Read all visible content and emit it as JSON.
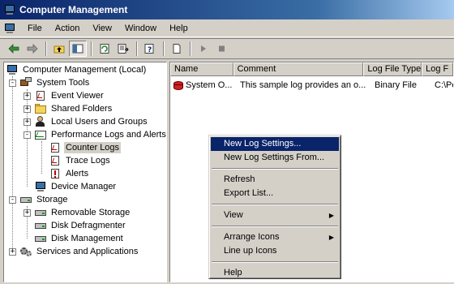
{
  "window": {
    "title": "Computer Management"
  },
  "menubar": {
    "items": [
      "File",
      "Action",
      "View",
      "Window",
      "Help"
    ]
  },
  "toolbar": {
    "buttons": [
      "back-arrow-icon",
      "forward-arrow-icon",
      "up-folder-icon",
      "show-hide-tree-icon",
      "refresh-icon",
      "export-list-icon",
      "help-icon",
      "new-log-icon",
      "start-icon",
      "stop-icon"
    ]
  },
  "tree": {
    "root": "Computer Management (Local)",
    "system_tools": "System Tools",
    "event_viewer": "Event Viewer",
    "shared_folders": "Shared Folders",
    "local_users": "Local Users and Groups",
    "perf_logs": "Performance Logs and Alerts",
    "counter_logs": "Counter Logs",
    "trace_logs": "Trace Logs",
    "alerts": "Alerts",
    "device_manager": "Device Manager",
    "storage": "Storage",
    "removable_storage": "Removable Storage",
    "disk_defrag": "Disk Defragmenter",
    "disk_mgmt": "Disk Management",
    "services_apps": "Services and Applications",
    "expanders": {
      "plus": "+",
      "minus": "-"
    }
  },
  "list": {
    "columns": [
      "Name",
      "Comment",
      "Log File Type",
      "Log F"
    ],
    "rows": [
      {
        "name": "System O...",
        "comment": "This sample log provides an o...",
        "type": "Binary File",
        "file": "C:\\Pe"
      }
    ]
  },
  "context_menu": {
    "new_log_settings": "New Log Settings...",
    "new_log_settings_from": "New Log Settings From...",
    "refresh": "Refresh",
    "export_list": "Export List...",
    "view": "View",
    "arrange_icons": "Arrange Icons",
    "line_up_icons": "Line up Icons",
    "help": "Help",
    "submenu_arrow": "▶"
  },
  "colors": {
    "highlight": "#0a246a",
    "title_start": "#0a246a",
    "face": "#d4d0c8"
  }
}
